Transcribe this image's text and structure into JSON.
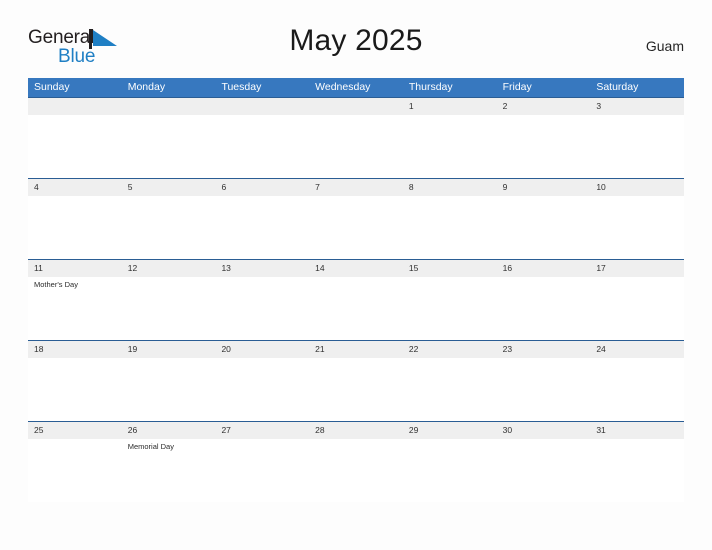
{
  "brand": {
    "name_part1": "General",
    "name_part2": "Blue",
    "flag_color": "#1f7fc4",
    "pole_color": "#231f20"
  },
  "header": {
    "title": "May 2025",
    "location": "Guam"
  },
  "colors": {
    "header_blue": "#3778bf",
    "band_gray": "#efefef",
    "band_border": "#2a5d94",
    "page_background": "#fdfdfd",
    "text_dark": "#303030"
  },
  "weekdays": [
    {
      "label": "Sunday"
    },
    {
      "label": "Monday"
    },
    {
      "label": "Tuesday"
    },
    {
      "label": "Wednesday"
    },
    {
      "label": "Thursday"
    },
    {
      "label": "Friday"
    },
    {
      "label": "Saturday"
    }
  ],
  "weeks": [
    {
      "days": [
        {
          "date": "",
          "event": ""
        },
        {
          "date": "",
          "event": ""
        },
        {
          "date": "",
          "event": ""
        },
        {
          "date": "",
          "event": ""
        },
        {
          "date": "1",
          "event": ""
        },
        {
          "date": "2",
          "event": ""
        },
        {
          "date": "3",
          "event": ""
        }
      ]
    },
    {
      "days": [
        {
          "date": "4",
          "event": ""
        },
        {
          "date": "5",
          "event": ""
        },
        {
          "date": "6",
          "event": ""
        },
        {
          "date": "7",
          "event": ""
        },
        {
          "date": "8",
          "event": ""
        },
        {
          "date": "9",
          "event": ""
        },
        {
          "date": "10",
          "event": ""
        }
      ]
    },
    {
      "days": [
        {
          "date": "11",
          "event": "Mother's Day"
        },
        {
          "date": "12",
          "event": ""
        },
        {
          "date": "13",
          "event": ""
        },
        {
          "date": "14",
          "event": ""
        },
        {
          "date": "15",
          "event": ""
        },
        {
          "date": "16",
          "event": ""
        },
        {
          "date": "17",
          "event": ""
        }
      ]
    },
    {
      "days": [
        {
          "date": "18",
          "event": ""
        },
        {
          "date": "19",
          "event": ""
        },
        {
          "date": "20",
          "event": ""
        },
        {
          "date": "21",
          "event": ""
        },
        {
          "date": "22",
          "event": ""
        },
        {
          "date": "23",
          "event": ""
        },
        {
          "date": "24",
          "event": ""
        }
      ]
    },
    {
      "days": [
        {
          "date": "25",
          "event": ""
        },
        {
          "date": "26",
          "event": "Memorial Day"
        },
        {
          "date": "27",
          "event": ""
        },
        {
          "date": "28",
          "event": ""
        },
        {
          "date": "29",
          "event": ""
        },
        {
          "date": "30",
          "event": ""
        },
        {
          "date": "31",
          "event": ""
        }
      ]
    }
  ]
}
